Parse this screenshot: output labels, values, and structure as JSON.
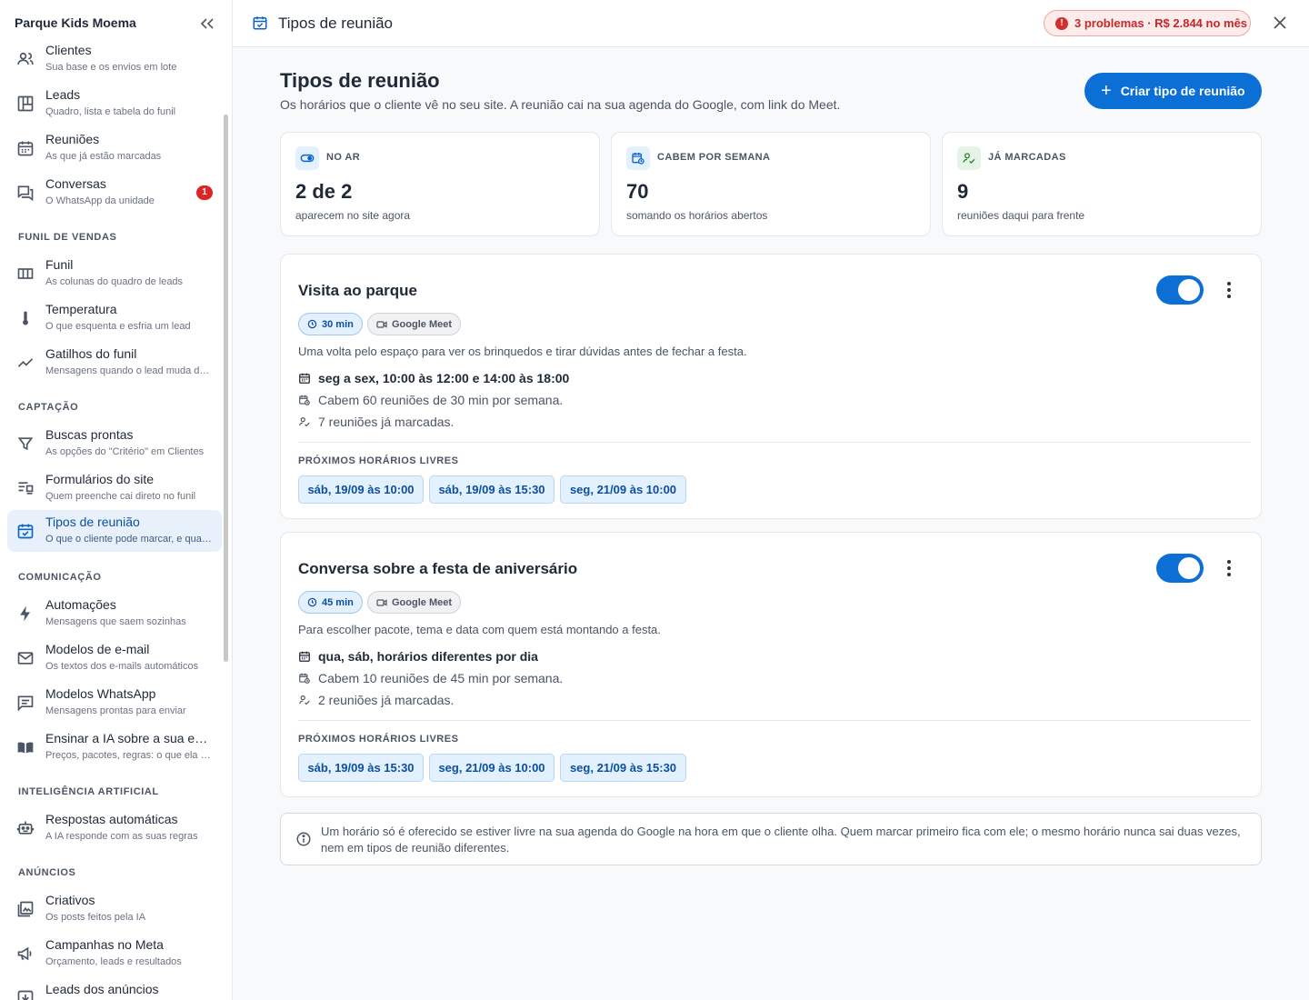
{
  "sidebar": {
    "title": "Parque Kids Moema",
    "collapse_icon": "double-chevron-left-icon",
    "items": [
      {
        "label": "Clientes",
        "sub": "Sua base e os envios em lote",
        "icon": "people-icon"
      },
      {
        "label": "Leads",
        "sub": "Quadro, lista e tabela do funil",
        "icon": "board-icon"
      },
      {
        "label": "Reuniões",
        "sub": "As que já estão marcadas",
        "icon": "calendar-icon"
      },
      {
        "label": "Conversas",
        "sub": "O WhatsApp da unidade",
        "icon": "chat-icon",
        "badge": "1"
      },
      {
        "label": "Funil",
        "sub": "As colunas do quadro de leads",
        "icon": "columns-icon"
      },
      {
        "label": "Temperatura",
        "sub": "O que esquenta e esfria um lead",
        "icon": "thermometer-icon"
      },
      {
        "label": "Gatilhos do funil",
        "sub": "Mensagens quando o lead muda de etapa",
        "icon": "trend-icon"
      },
      {
        "label": "Buscas prontas",
        "sub": "As opções do \"Critério\" em Clientes",
        "icon": "filter-icon"
      },
      {
        "label": "Formulários do site",
        "sub": "Quem preenche cai direto no funil",
        "icon": "form-icon"
      },
      {
        "label": "Tipos de reunião",
        "sub": "O que o cliente pode marcar, e quando",
        "icon": "calendar-check-icon"
      },
      {
        "label": "Automações",
        "sub": "Mensagens que saem sozinhas",
        "icon": "bolt-icon"
      },
      {
        "label": "Modelos de e-mail",
        "sub": "Os textos dos e-mails automáticos",
        "icon": "mail-icon"
      },
      {
        "label": "Modelos WhatsApp",
        "sub": "Mensagens prontas para enviar",
        "icon": "message-icon"
      },
      {
        "label": "Ensinar a IA sobre a sua empresa",
        "sub": "Preços, pacotes, regras: o que ela precisa saber",
        "icon": "book-icon"
      },
      {
        "label": "Respostas automáticas",
        "sub": "A IA responde com as suas regras",
        "icon": "robot-icon"
      },
      {
        "label": "Criativos",
        "sub": "Os posts feitos pela IA",
        "icon": "image-icon"
      },
      {
        "label": "Campanhas no Meta",
        "sub": "Orçamento, leads e resultados",
        "icon": "megaphone-icon"
      },
      {
        "label": "Leads dos anúncios",
        "sub": "",
        "icon": "download-icon"
      }
    ],
    "sections": {
      "funil": "FUNIL DE VENDAS",
      "captacao": "CAPTAÇÃO",
      "comunicacao": "COMUNICAÇÃO",
      "ia": "INTELIGÊNCIA ARTIFICIAL",
      "anuncios": "ANÚNCIOS"
    }
  },
  "topbar": {
    "title": "Tipos de reunião",
    "problems": "3 problemas · R$ 2.844 no mês",
    "close_icon": "close-icon"
  },
  "page": {
    "title": "Tipos de reunião",
    "subtitle": "Os horários que o cliente vê no seu site. A reunião cai na sua agenda do Google, com link do Meet.",
    "create_label": "Criar tipo de reunião"
  },
  "stats": [
    {
      "label": "NO AR",
      "value": "2 de 2",
      "desc": "aparecem no site agora",
      "icon": "toggle-icon",
      "color": "#0b63c9"
    },
    {
      "label": "CABEM POR SEMANA",
      "value": "70",
      "desc": "somando os horários abertos",
      "icon": "calendar-clock-icon",
      "color": "#0b63c9"
    },
    {
      "label": "JÁ MARCADAS",
      "value": "9",
      "desc": "reuniões daqui para frente",
      "icon": "person-check-icon",
      "color": "#2e7d32"
    }
  ],
  "meeting_types": [
    {
      "title": "Visita ao parque",
      "enabled": true,
      "duration": "30 min",
      "platform": "Google Meet",
      "description": "Uma volta pelo espaço para ver os brinquedos e tirar dúvidas antes de fechar a festa.",
      "schedule": "seg a sex, 10:00 às 12:00 e 14:00 às 18:00",
      "capacity": "Cabem 60 reuniões de 30 min por semana.",
      "booked": "7 reuniões já marcadas.",
      "slots_title": "PRÓXIMOS HORÁRIOS LIVRES",
      "slots": [
        "sáb, 19/09 às 10:00",
        "sáb, 19/09 às 15:30",
        "seg, 21/09 às 10:00"
      ]
    },
    {
      "title": "Conversa sobre a festa de aniversário",
      "enabled": true,
      "duration": "45 min",
      "platform": "Google Meet",
      "description": "Para escolher pacote, tema e data com quem está montando a festa.",
      "schedule": "qua, sáb, horários diferentes por dia",
      "capacity": "Cabem 10 reuniões de 45 min por semana.",
      "booked": "2 reuniões já marcadas.",
      "slots_title": "PRÓXIMOS HORÁRIOS LIVRES",
      "slots": [
        "sáb, 19/09 às 15:30",
        "seg, 21/09 às 10:00",
        "seg, 21/09 às 15:30"
      ]
    }
  ],
  "info_note": "Um horário só é oferecido se estiver livre na sua agenda do Google na hora em que o cliente olha. Quem marcar primeiro fica com ele; o mesmo horário nunca sai duas vezes, nem em tipos de reunião diferentes.",
  "colors": {
    "accent": "#0b6fd6",
    "danger": "#d32f2f",
    "active_nav": "#e8f1fb"
  }
}
